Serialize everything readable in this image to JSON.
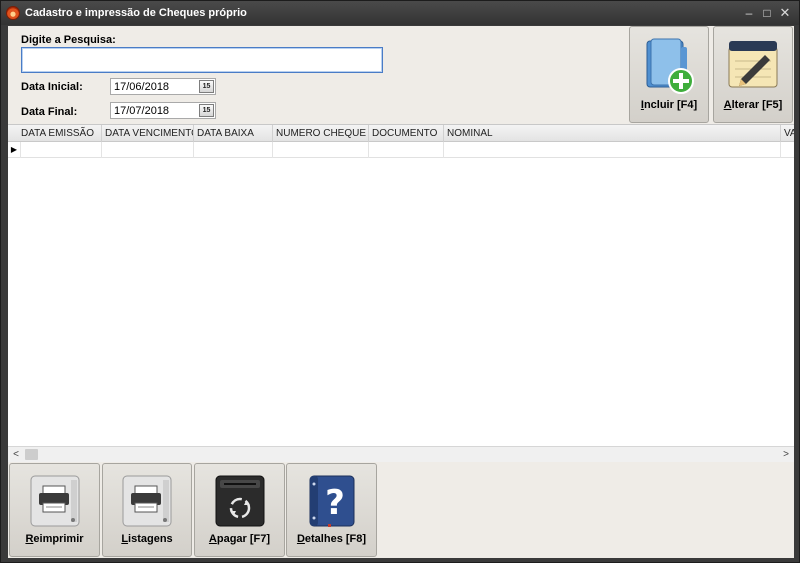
{
  "window": {
    "title": "Cadastro e impressão de Cheques próprio",
    "controls": {
      "minimize": "–",
      "maximize": "□",
      "close": "✕"
    }
  },
  "search": {
    "label": "Digite a Pesquisa:",
    "value": ""
  },
  "dates": {
    "start_label": "Data Inicial:",
    "start_value": "17/06/2018",
    "end_label": "Data Final:",
    "end_value": "17/07/2018",
    "calendar_glyph": "15"
  },
  "actions_top": [
    {
      "id": "incluir",
      "label_u": "I",
      "label_rest": "ncluir [F4]",
      "icon": "folder-add-icon"
    },
    {
      "id": "alterar",
      "label_u": "A",
      "label_rest": "lterar [F5]",
      "icon": "notepad-pencil-icon"
    }
  ],
  "grid": {
    "columns": [
      "DATA EMISSÃO",
      "DATA VENCIMENTO",
      "DATA BAIXA",
      "NUMERO CHEQUE",
      "DOCUMENTO",
      "NOMINAL",
      "VA"
    ],
    "row_indicator": "▶"
  },
  "scroll": {
    "left": "<",
    "right": ">"
  },
  "actions_bottom": [
    {
      "id": "reimprimir",
      "label_u": "R",
      "label_rest": "eimprimir",
      "icon": "printer-icon"
    },
    {
      "id": "listagens",
      "label_u": "L",
      "label_rest": "istagens",
      "icon": "printer-icon"
    },
    {
      "id": "apagar",
      "label_u": "A",
      "label_rest": "pagar [F7]",
      "icon": "recycle-bin-icon"
    },
    {
      "id": "detalhes",
      "label_u": "D",
      "label_rest": "etalhes [F8]",
      "icon": "help-book-icon"
    }
  ],
  "colors": {
    "titlebar": "#3a3a3a",
    "client": "#efece7",
    "accent_input_border": "#4a7cc6"
  }
}
